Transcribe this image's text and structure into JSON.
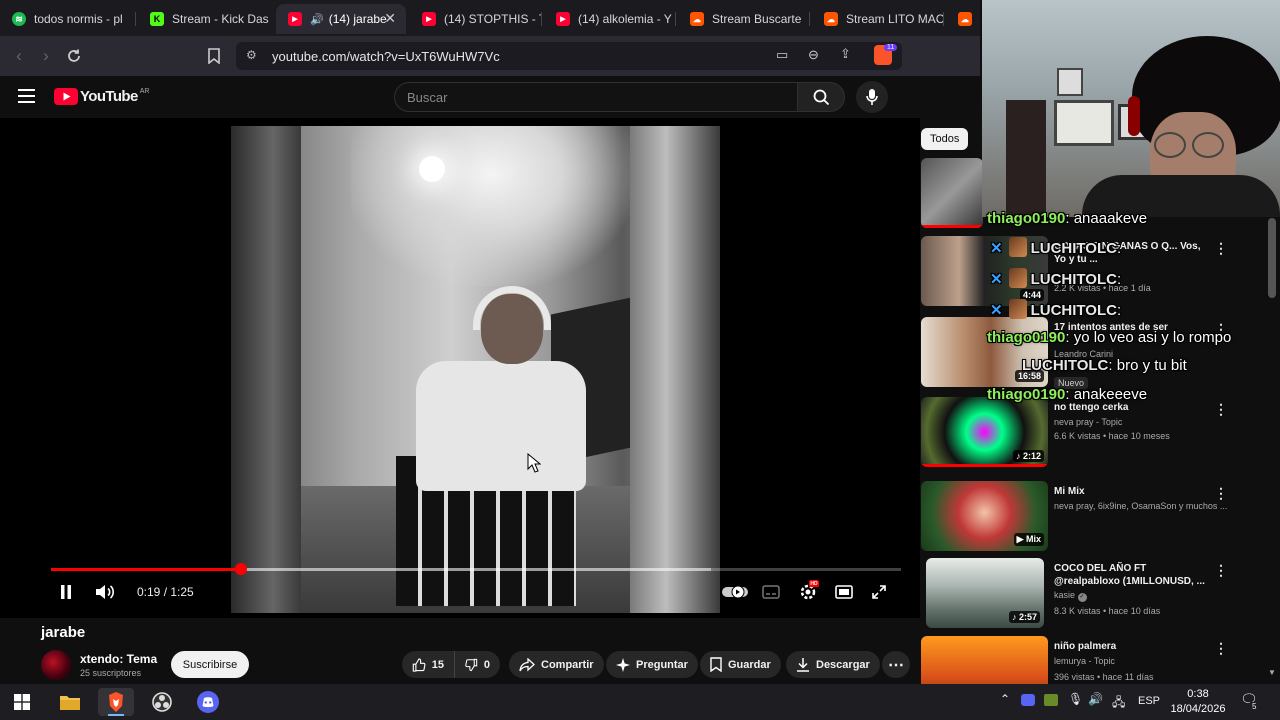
{
  "browser": {
    "tabs": [
      {
        "title": "todos normis - pl",
        "favicon": "spotify-icon",
        "color": "#1db954"
      },
      {
        "title": "Stream - Kick Das",
        "favicon": "kick-icon",
        "color": "#53fc18"
      },
      {
        "title": "(14) jarabe",
        "favicon": "youtube-icon",
        "color": "#ff0033",
        "active": true,
        "audio": true
      },
      {
        "title": "(14) STOPTHIS - T",
        "favicon": "youtube-icon",
        "color": "#ff0033"
      },
      {
        "title": "(14) alkolemia - Y",
        "favicon": "youtube-icon",
        "color": "#ff0033"
      },
      {
        "title": "Stream Buscarte",
        "favicon": "soundcloud-icon",
        "color": "#ff5500"
      },
      {
        "title": "Stream LITO MAC",
        "favicon": "soundcloud-icon",
        "color": "#ff5500"
      },
      {
        "title": "",
        "favicon": "soundcloud-icon",
        "color": "#ff5500"
      }
    ],
    "url": "youtube.com/watch?v=UxT6WuHW7Vc",
    "shield_badge": "11"
  },
  "youtube": {
    "logo_text": "YouTube",
    "region": "AR",
    "search_placeholder": "Buscar",
    "player": {
      "current_time": "0:19",
      "duration": "1:25",
      "time_display": "0:19 / 1:25",
      "played_fraction": 0.223,
      "buffered_fraction": 0.776,
      "playing": true
    },
    "video": {
      "title": "jarabe",
      "channel": "xtendo: Tema",
      "subscribers": "25 suscriptores",
      "subscribe_label": "Suscribirse",
      "likes": "15",
      "dislikes": "0",
      "share_label": "Compartir",
      "ask_label": "Preguntar",
      "save_label": "Guardar",
      "download_label": "Descargar"
    },
    "sidebar": {
      "chip": "Todos",
      "items": [
        {
          "title": "",
          "channel": "",
          "meta": "",
          "duration": ""
        },
        {
          "title": "COSAS SIN GANAS O Q... Vos, Yo y tu ...",
          "channel": "",
          "meta": "2.2 K vistas • hace 1 día",
          "duration": "4:44"
        },
        {
          "title": "17 intentos antes de ser",
          "channel": "Leandro Carini",
          "meta": "",
          "duration": "16:58",
          "badge": "Nuevo"
        },
        {
          "title": "no ttengo cerka",
          "channel": "neva pray - Topic",
          "meta": "6.6 K vistas • hace 10 meses",
          "duration": "2:12"
        },
        {
          "title": "Mi Mix",
          "channel": "neva pray, 6ix9ine, OsamaSon y muchos ...",
          "meta": "",
          "duration": "Mix"
        },
        {
          "title": "COCO DEL AÑO FT @realpabloxo (1MILLONUSD, ...",
          "channel": "kasie",
          "meta": "8.3 K vistas • hace 10 días",
          "duration": "2:57"
        },
        {
          "title": "niño palmera",
          "channel": "lemurya - Topic",
          "meta": "396 vistas • hace 11 días",
          "duration": ""
        }
      ]
    }
  },
  "chat": [
    {
      "user": "thiago0190",
      "text": ": anaaakeve"
    },
    {
      "user": "LUCHITOLC",
      "text": ":"
    },
    {
      "user": "LUCHITOLC",
      "text": ":"
    },
    {
      "user": "LUCHITOLC",
      "text": ":"
    },
    {
      "user": "thiago0190",
      "text": ": yo lo veo asi y lo rompo"
    },
    {
      "user": "LUCHITOLC",
      "text": ": bro y tu bit"
    },
    {
      "user": "thiago0190",
      "text": ": anakeeeve"
    }
  ],
  "taskbar": {
    "language": "ESP",
    "time": "0:38",
    "date": "18/04/2026",
    "notifications": "5"
  }
}
